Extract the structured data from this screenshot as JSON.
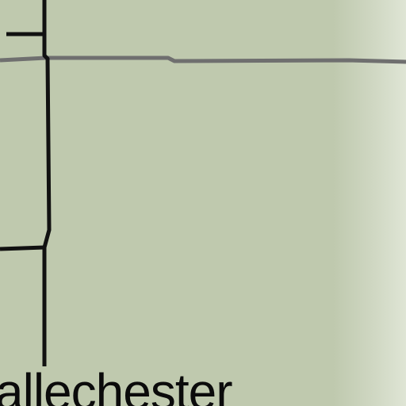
{
  "map": {
    "place_label": "allechester",
    "colors": {
      "land": "#bfc9ae",
      "land_edge_fade": "#dfe5d5",
      "boundary_line": "#111111",
      "road_line": "#6f6f6f"
    }
  }
}
